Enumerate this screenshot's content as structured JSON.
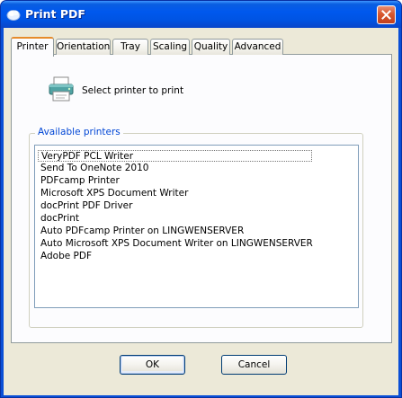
{
  "window": {
    "title": "Print PDF"
  },
  "tabs": [
    {
      "label": "Printer"
    },
    {
      "label": "Orientation"
    },
    {
      "label": "Tray"
    },
    {
      "label": "Scaling"
    },
    {
      "label": "Quality"
    },
    {
      "label": "Advanced"
    }
  ],
  "printer_tab": {
    "instruction": "Select printer to print",
    "group_label": "Available printers",
    "printers": [
      "VeryPDF PCL Writer",
      "Send To OneNote 2010",
      "PDFcamp Printer",
      "Microsoft XPS Document Writer",
      "docPrint PDF Driver",
      "docPrint",
      "Auto PDFcamp Printer on LINGWENSERVER",
      "Auto Microsoft XPS Document Writer on LINGWENSERVER",
      "Adobe PDF"
    ]
  },
  "buttons": {
    "ok": "OK",
    "cancel": "Cancel"
  },
  "colors": {
    "titlebar": "#0054e3",
    "dialog_face": "#ece9d8",
    "group_label": "#0046d5",
    "active_tab_accent": "#e68b2c"
  },
  "icons": {
    "app": "app-icon",
    "close": "close-icon",
    "printer": "printer-icon"
  }
}
